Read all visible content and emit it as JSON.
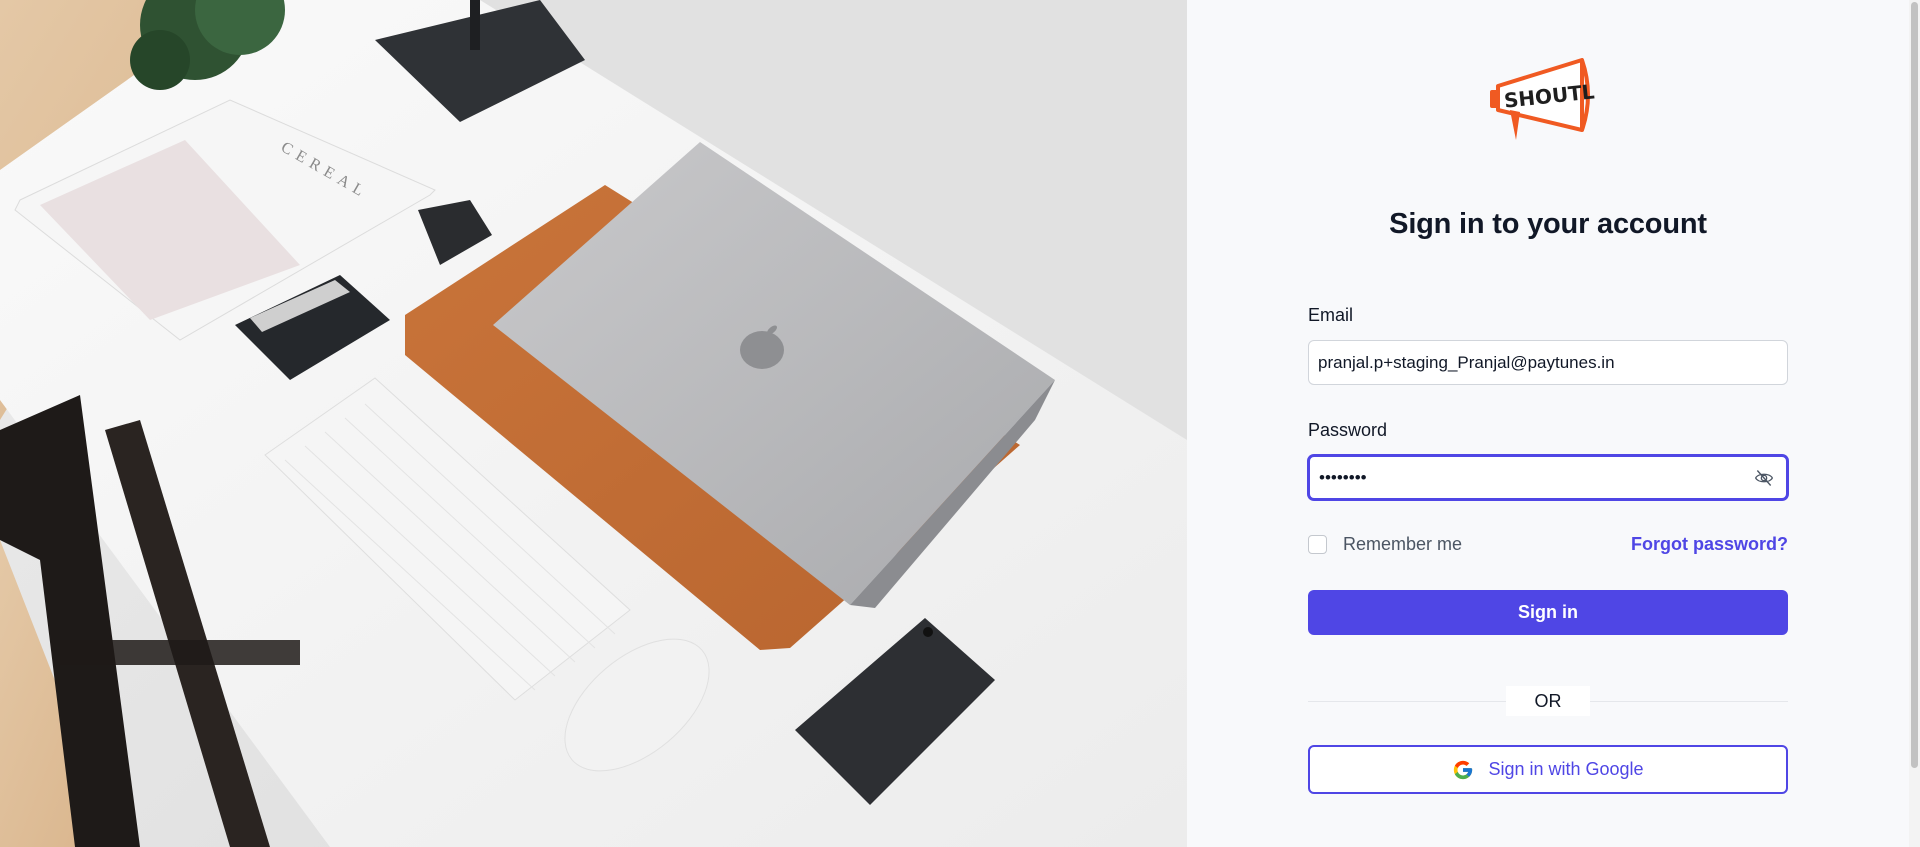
{
  "brand": {
    "logo_text": "SHOUTL",
    "accent": "#f05a22"
  },
  "hero": {
    "magazine_text": "CEREAL"
  },
  "form": {
    "title": "Sign in to your account",
    "email_label": "Email",
    "email_value": "pranjal.p+staging_Pranjal@paytunes.in",
    "password_label": "Password",
    "password_value": "........",
    "remember_label": "Remember me",
    "forgot_label": "Forgot password?",
    "signin_label": "Sign in",
    "or_label": "OR",
    "google_label": "Sign in with Google"
  },
  "colors": {
    "primary": "#4f46e5",
    "text": "#111827",
    "muted": "#4b5563"
  }
}
